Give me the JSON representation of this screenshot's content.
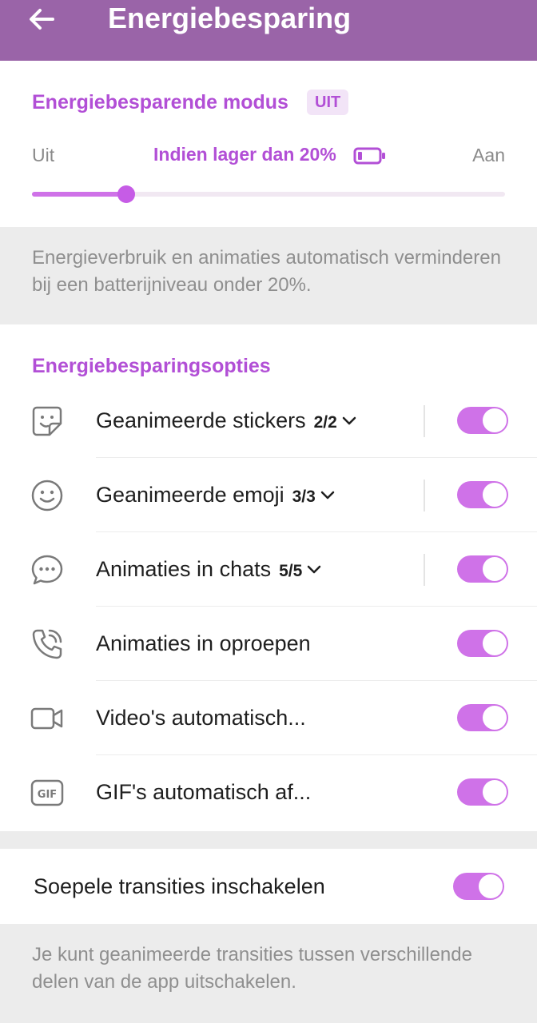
{
  "header": {
    "title": "Energiebesparing",
    "back_icon": "arrow-left-icon"
  },
  "mode": {
    "title": "Energiebesparende modus",
    "badge": "UIT",
    "slider": {
      "min_label": "Uit",
      "max_label": "Aan",
      "current_label": "Indien lager dan 20%",
      "value_fraction": 0.2,
      "icon": "battery-low-icon"
    },
    "description": "Energieverbruik en animaties automatisch verminderen bij een batterijniveau onder 20%."
  },
  "options": {
    "title": "Energiebesparingsopties",
    "items": [
      {
        "label": "Geanimeerde stickers",
        "count": "2/2",
        "icon": "sticker-icon",
        "enabled": true
      },
      {
        "label": "Geanimeerde emoji",
        "count": "3/3",
        "icon": "smiley-icon",
        "enabled": true
      },
      {
        "label": "Animaties in chats",
        "count": "5/5",
        "icon": "chat-bubble-icon",
        "enabled": true
      },
      {
        "label": "Animaties in oproepen",
        "count": "",
        "icon": "phone-call-icon",
        "enabled": true
      },
      {
        "label": "Video's automatisch...",
        "count": "",
        "icon": "video-camera-icon",
        "enabled": true
      },
      {
        "label": "GIF's automatisch af...",
        "count": "",
        "icon": "gif-icon",
        "enabled": true
      }
    ]
  },
  "smooth": {
    "label": "Soepele transities inschakelen",
    "enabled": true,
    "description": "Je kunt geanimeerde transities tussen verschillende delen van de app uitschakelen."
  },
  "colors": {
    "header_bg": "#9a64a8",
    "accent": "#b24fd6",
    "toggle_on": "#cf72e8"
  }
}
